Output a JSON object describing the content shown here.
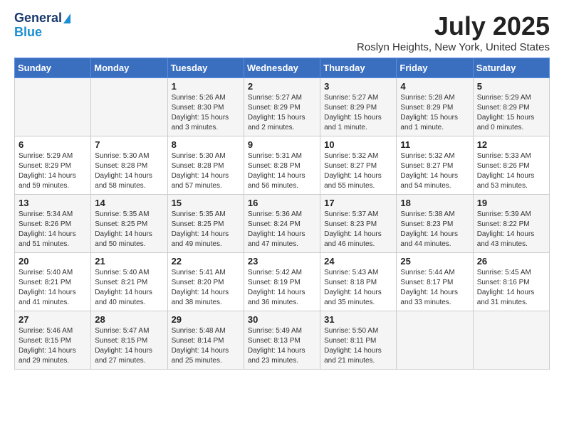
{
  "header": {
    "logo_line1": "General",
    "logo_line2": "Blue",
    "main_title": "July 2025",
    "subtitle": "Roslyn Heights, New York, United States"
  },
  "days_of_week": [
    "Sunday",
    "Monday",
    "Tuesday",
    "Wednesday",
    "Thursday",
    "Friday",
    "Saturday"
  ],
  "weeks": [
    [
      {
        "day": "",
        "info": ""
      },
      {
        "day": "",
        "info": ""
      },
      {
        "day": "1",
        "info": "Sunrise: 5:26 AM\nSunset: 8:30 PM\nDaylight: 15 hours and 3 minutes."
      },
      {
        "day": "2",
        "info": "Sunrise: 5:27 AM\nSunset: 8:29 PM\nDaylight: 15 hours and 2 minutes."
      },
      {
        "day": "3",
        "info": "Sunrise: 5:27 AM\nSunset: 8:29 PM\nDaylight: 15 hours and 1 minute."
      },
      {
        "day": "4",
        "info": "Sunrise: 5:28 AM\nSunset: 8:29 PM\nDaylight: 15 hours and 1 minute."
      },
      {
        "day": "5",
        "info": "Sunrise: 5:29 AM\nSunset: 8:29 PM\nDaylight: 15 hours and 0 minutes."
      }
    ],
    [
      {
        "day": "6",
        "info": "Sunrise: 5:29 AM\nSunset: 8:29 PM\nDaylight: 14 hours and 59 minutes."
      },
      {
        "day": "7",
        "info": "Sunrise: 5:30 AM\nSunset: 8:28 PM\nDaylight: 14 hours and 58 minutes."
      },
      {
        "day": "8",
        "info": "Sunrise: 5:30 AM\nSunset: 8:28 PM\nDaylight: 14 hours and 57 minutes."
      },
      {
        "day": "9",
        "info": "Sunrise: 5:31 AM\nSunset: 8:28 PM\nDaylight: 14 hours and 56 minutes."
      },
      {
        "day": "10",
        "info": "Sunrise: 5:32 AM\nSunset: 8:27 PM\nDaylight: 14 hours and 55 minutes."
      },
      {
        "day": "11",
        "info": "Sunrise: 5:32 AM\nSunset: 8:27 PM\nDaylight: 14 hours and 54 minutes."
      },
      {
        "day": "12",
        "info": "Sunrise: 5:33 AM\nSunset: 8:26 PM\nDaylight: 14 hours and 53 minutes."
      }
    ],
    [
      {
        "day": "13",
        "info": "Sunrise: 5:34 AM\nSunset: 8:26 PM\nDaylight: 14 hours and 51 minutes."
      },
      {
        "day": "14",
        "info": "Sunrise: 5:35 AM\nSunset: 8:25 PM\nDaylight: 14 hours and 50 minutes."
      },
      {
        "day": "15",
        "info": "Sunrise: 5:35 AM\nSunset: 8:25 PM\nDaylight: 14 hours and 49 minutes."
      },
      {
        "day": "16",
        "info": "Sunrise: 5:36 AM\nSunset: 8:24 PM\nDaylight: 14 hours and 47 minutes."
      },
      {
        "day": "17",
        "info": "Sunrise: 5:37 AM\nSunset: 8:23 PM\nDaylight: 14 hours and 46 minutes."
      },
      {
        "day": "18",
        "info": "Sunrise: 5:38 AM\nSunset: 8:23 PM\nDaylight: 14 hours and 44 minutes."
      },
      {
        "day": "19",
        "info": "Sunrise: 5:39 AM\nSunset: 8:22 PM\nDaylight: 14 hours and 43 minutes."
      }
    ],
    [
      {
        "day": "20",
        "info": "Sunrise: 5:40 AM\nSunset: 8:21 PM\nDaylight: 14 hours and 41 minutes."
      },
      {
        "day": "21",
        "info": "Sunrise: 5:40 AM\nSunset: 8:21 PM\nDaylight: 14 hours and 40 minutes."
      },
      {
        "day": "22",
        "info": "Sunrise: 5:41 AM\nSunset: 8:20 PM\nDaylight: 14 hours and 38 minutes."
      },
      {
        "day": "23",
        "info": "Sunrise: 5:42 AM\nSunset: 8:19 PM\nDaylight: 14 hours and 36 minutes."
      },
      {
        "day": "24",
        "info": "Sunrise: 5:43 AM\nSunset: 8:18 PM\nDaylight: 14 hours and 35 minutes."
      },
      {
        "day": "25",
        "info": "Sunrise: 5:44 AM\nSunset: 8:17 PM\nDaylight: 14 hours and 33 minutes."
      },
      {
        "day": "26",
        "info": "Sunrise: 5:45 AM\nSunset: 8:16 PM\nDaylight: 14 hours and 31 minutes."
      }
    ],
    [
      {
        "day": "27",
        "info": "Sunrise: 5:46 AM\nSunset: 8:15 PM\nDaylight: 14 hours and 29 minutes."
      },
      {
        "day": "28",
        "info": "Sunrise: 5:47 AM\nSunset: 8:15 PM\nDaylight: 14 hours and 27 minutes."
      },
      {
        "day": "29",
        "info": "Sunrise: 5:48 AM\nSunset: 8:14 PM\nDaylight: 14 hours and 25 minutes."
      },
      {
        "day": "30",
        "info": "Sunrise: 5:49 AM\nSunset: 8:13 PM\nDaylight: 14 hours and 23 minutes."
      },
      {
        "day": "31",
        "info": "Sunrise: 5:50 AM\nSunset: 8:11 PM\nDaylight: 14 hours and 21 minutes."
      },
      {
        "day": "",
        "info": ""
      },
      {
        "day": "",
        "info": ""
      }
    ]
  ]
}
